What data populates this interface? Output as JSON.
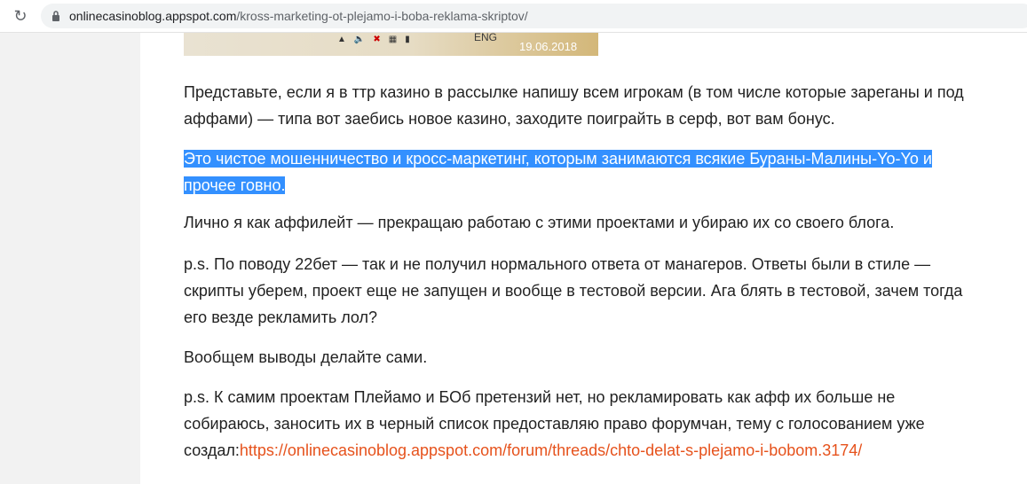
{
  "browser": {
    "url_host": "onlinecasinoblog.appspot.com",
    "url_path": "/kross-marketing-ot-plejamo-i-boba-reklama-skriptov/"
  },
  "screenshot_crop": {
    "lang": "ENG",
    "date": "19.06.2018"
  },
  "article": {
    "p1": "Представьте, если я в ттр казино в рассылке напишу всем игрокам (в том числе которые зареганы и под аффами) — типа вот заебись новое казино, заходите поиграйть в серф, вот вам бонус.",
    "p2_line1": "Это чистое мошенничество и кросс-маркетинг, которым занимаются всякие Бураны-Малины-Yo-Yo и",
    "p2_line2": "прочее говно.",
    "p3": "Лично я как аффилейт — прекращаю работаю с этими проектами и убираю их со своего блога.",
    "p4": "p.s. По поводу 22бет — так и не получил нормального ответа от манагеров. Ответы были в стиле — скрипты уберем, проект еще не запущен и вообще в тестовой версии. Ага блять в тестовой, зачем тогда его везде рекламить лол?",
    "p5": "Вообщем выводы делайте сами.",
    "p6_text": "p.s. К самим проектам Плейамо и БОб претензий нет, но рекламировать как афф их больше не собираюсь, заносить их в черный список предоставляю право форумчан, тему с голосованием уже создал:",
    "p6_link": "https://onlinecasinoblog.appspot.com/forum/threads/chto-delat-s-plejamo-i-bobom.3174/"
  },
  "colors": {
    "highlight": "#3390ff",
    "link": "#e6521c"
  }
}
